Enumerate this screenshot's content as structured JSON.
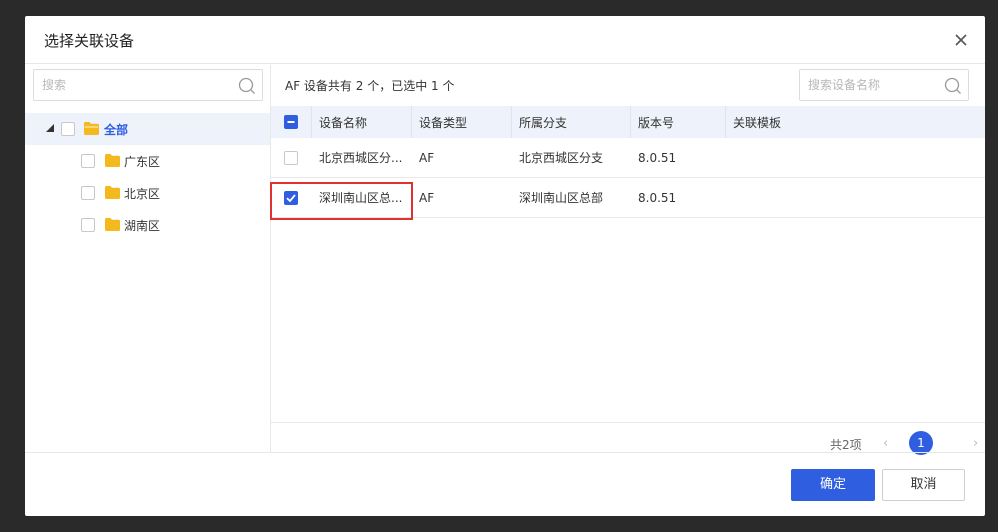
{
  "dialog": {
    "title": "选择关联设备"
  },
  "tree": {
    "search_placeholder": "搜索",
    "root": {
      "label": "全部",
      "expanded": true,
      "checked": false
    },
    "children": [
      {
        "label": "广东区",
        "checked": false
      },
      {
        "label": "北京区",
        "checked": false
      },
      {
        "label": "湖南区",
        "checked": false
      }
    ]
  },
  "list": {
    "summary": "AF 设备共有 2 个，已选中 1 个",
    "search_placeholder": "搜索设备名称",
    "columns": [
      "设备名称",
      "设备类型",
      "所属分支",
      "版本号",
      "关联模板"
    ],
    "header_checkbox_state": "indeterminate",
    "rows": [
      {
        "checked": false,
        "name": "北京西城区分...",
        "type": "AF",
        "branch": "北京西城区分支",
        "version": "8.0.51",
        "template": ""
      },
      {
        "checked": true,
        "name": "深圳南山区总...",
        "type": "AF",
        "branch": "深圳南山区总部",
        "version": "8.0.51",
        "template": ""
      }
    ]
  },
  "pagination": {
    "total": "共2项",
    "current_page": "1"
  },
  "footer": {
    "confirm_label": "确定",
    "cancel_label": "取消"
  },
  "colors": {
    "primary": "#2f5fe0",
    "highlight": "#e0322f",
    "folder": "#f5b920",
    "header_bg": "#eef2fa"
  }
}
